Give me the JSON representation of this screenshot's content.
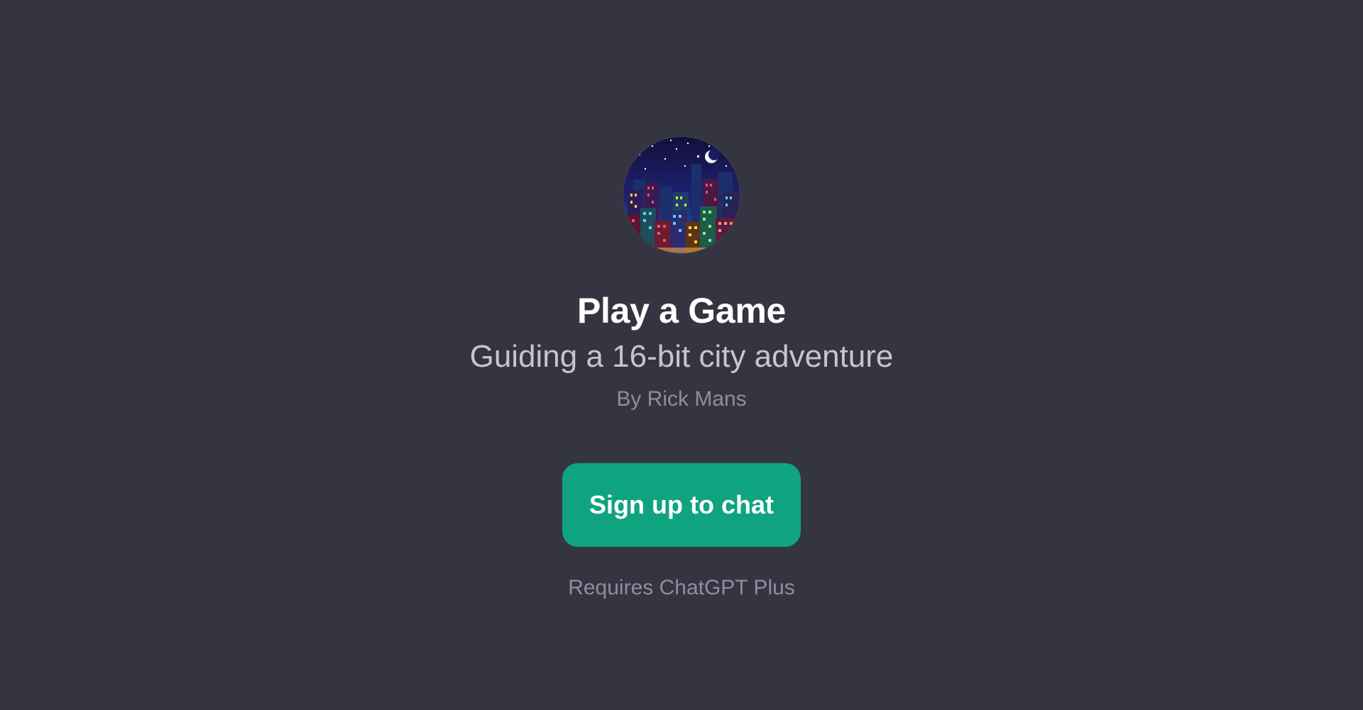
{
  "gpt": {
    "avatar_icon": "pixel-city-night-avatar",
    "name": "Play a Game",
    "description": "Guiding a 16-bit city adventure",
    "author": "By Rick Mans"
  },
  "actions": {
    "signup_label": "Sign up to chat"
  },
  "footer": {
    "requirement": "Requires ChatGPT Plus"
  },
  "colors": {
    "background": "#343541",
    "button": "#10a37f",
    "title": "#ffffff",
    "subtitle": "#c5c5d2",
    "muted": "#8e8ea0"
  }
}
